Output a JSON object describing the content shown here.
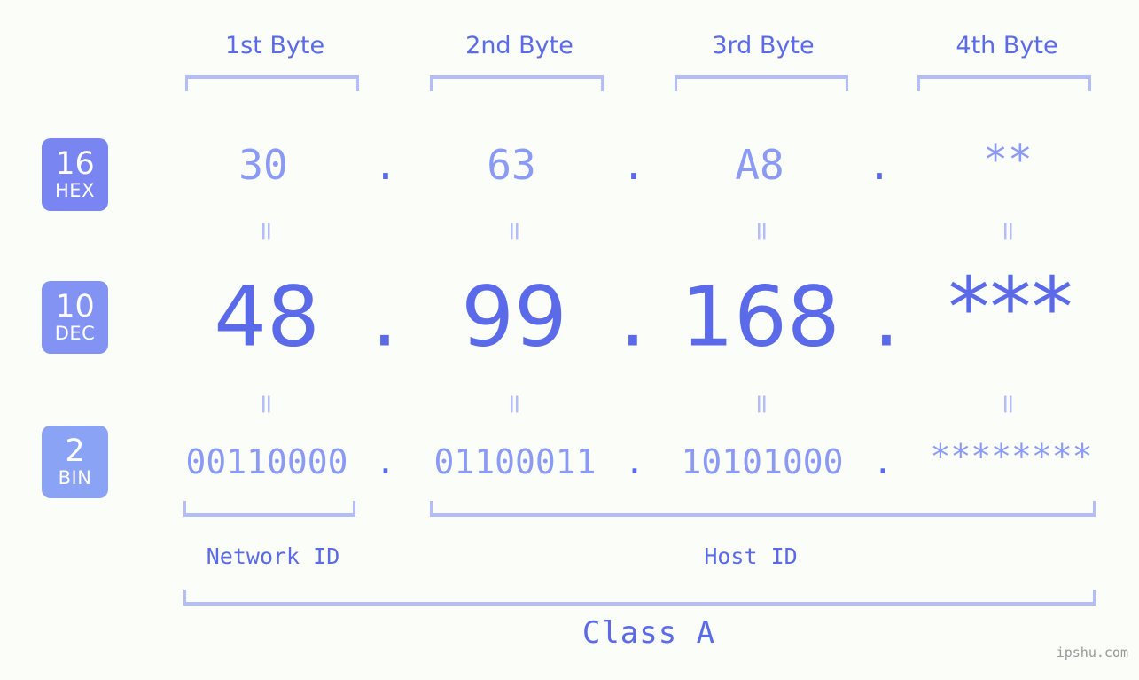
{
  "colors": {
    "background": "#fbfdf9",
    "accent_dark": "#5a6ae8",
    "accent_light": "#8b9bf5",
    "bracket": "#b3bdf9",
    "badge_hex": "#7986f2",
    "badge_dec": "#8293f4",
    "badge_bin": "#8ba3f5",
    "watermark": "#999999"
  },
  "headers": [
    {
      "label": "1st Byte"
    },
    {
      "label": "2nd Byte"
    },
    {
      "label": "3rd Byte"
    },
    {
      "label": "4th Byte"
    }
  ],
  "rows": {
    "hex": {
      "base_number": "16",
      "base_name": "HEX",
      "values": [
        "30",
        "63",
        "A8",
        "**"
      ],
      "separator": "."
    },
    "dec": {
      "base_number": "10",
      "base_name": "DEC",
      "values": [
        "48",
        "99",
        "168",
        "***"
      ],
      "separator": "."
    },
    "bin": {
      "base_number": "2",
      "base_name": "BIN",
      "values": [
        "00110000",
        "01100011",
        "10101000",
        "********"
      ],
      "separator": "."
    }
  },
  "equals_mark": "=",
  "footer": {
    "network_id_label": "Network ID",
    "host_id_label": "Host ID",
    "class_label": "Class A"
  },
  "watermark": "ipshu.com"
}
